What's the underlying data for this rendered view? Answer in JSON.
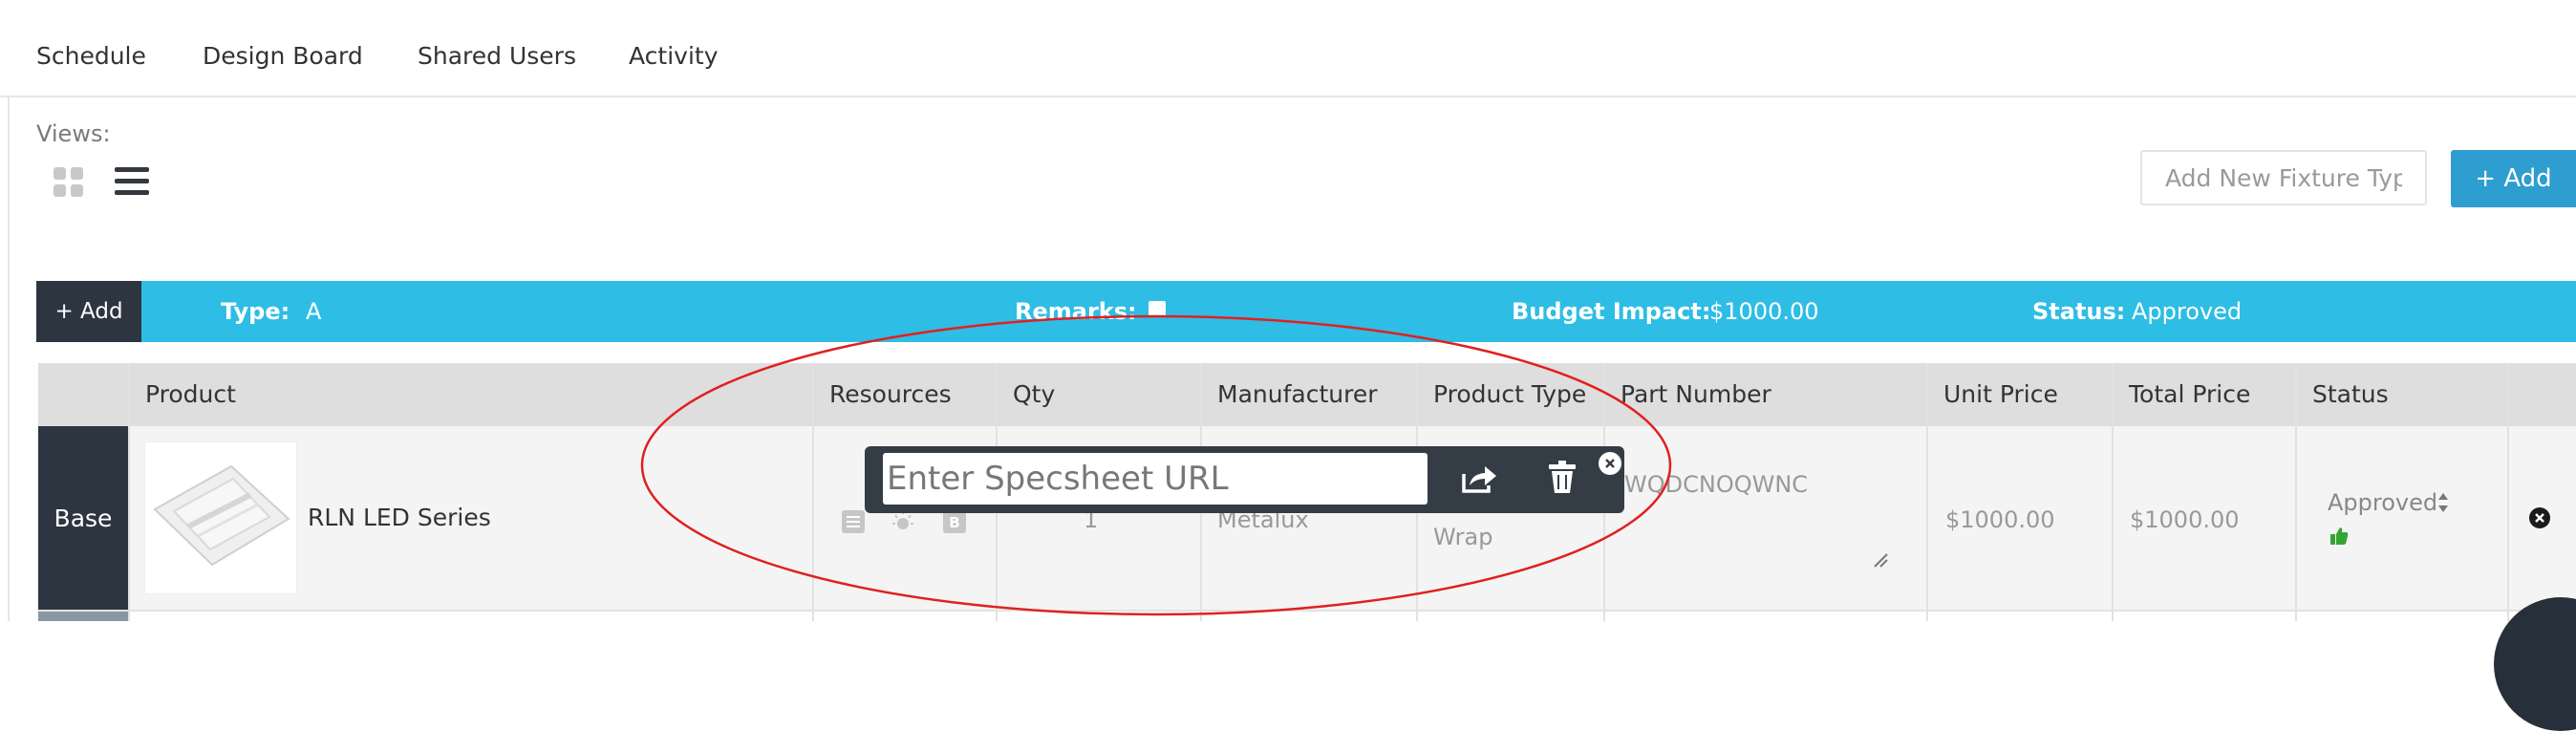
{
  "tabs": [
    {
      "label": "Schedule"
    },
    {
      "label": "Design Board"
    },
    {
      "label": "Shared Users"
    },
    {
      "label": "Activity"
    }
  ],
  "views": {
    "label": "Views:",
    "options": [
      {
        "icon": "grid-view-icon",
        "active": false
      },
      {
        "icon": "list-view-icon",
        "active": true
      }
    ]
  },
  "fixture": {
    "placeholder": "Add New Fixture Type",
    "add_label": "+ Add"
  },
  "type_bar": {
    "add_label": "+ Add",
    "type_label": "Type:",
    "type_value": "A",
    "remarks_label": "Remarks:",
    "budget_label": "Budget Impact:",
    "budget_value": "$1000.00",
    "status_label": "Status:",
    "status_value": "Approved",
    "color": "#2ebde4"
  },
  "table": {
    "headers": [
      "Product",
      "Resources",
      "Qty",
      "Manufacturer",
      "Product Type",
      "Part Number",
      "Unit Price",
      "Total Price",
      "Status"
    ],
    "rows": [
      {
        "row_label": "Base",
        "product": "RLN LED Series",
        "resources": [
          "document-icon",
          "light-icon",
          "b-icon"
        ],
        "qty": "1",
        "manufacturer": "Metalux",
        "product_type": "Wrap",
        "part_number": "WQDCNOQWNC",
        "unit_price": "$1000.00",
        "total_price": "$1000.00",
        "status": "Approved",
        "status_icon": "thumbs-up-icon"
      }
    ]
  },
  "specsheet_popup": {
    "placeholder": "Enter Specsheet URL",
    "icons": [
      "share-icon",
      "trash-icon",
      "close-icon"
    ]
  },
  "annotation": {
    "shape": "ellipse",
    "color": "#e02020"
  }
}
